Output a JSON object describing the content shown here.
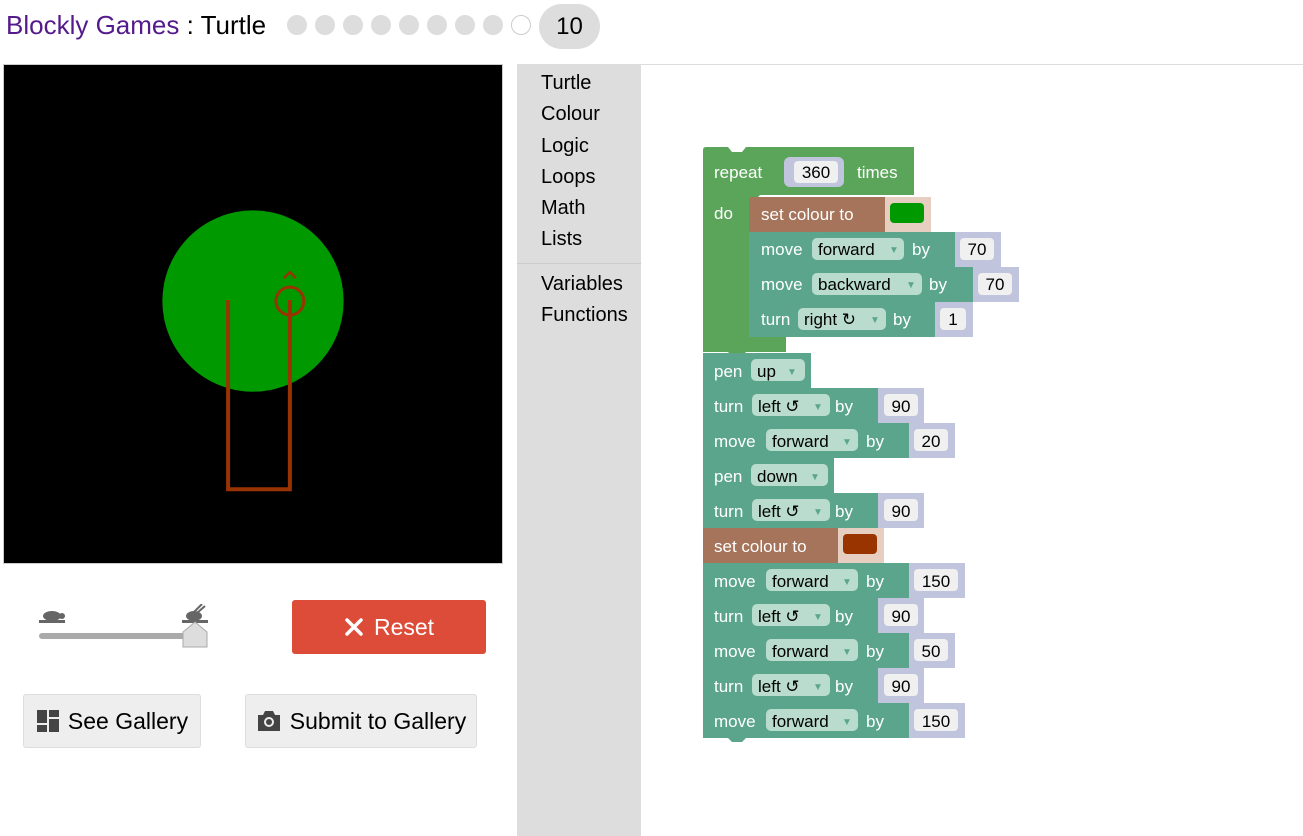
{
  "header": {
    "app_name": "Blockly Games",
    "separator": " : ",
    "level_name": "Turtle",
    "level_count": 10,
    "current_level": "10"
  },
  "controls": {
    "reset_label": "Reset",
    "see_gallery_label": "See Gallery",
    "submit_gallery_label": "Submit to Gallery",
    "speed_slow_icon": "turtle-icon",
    "speed_fast_icon": "rabbit-icon",
    "speed_value": 1.0
  },
  "toolbox": {
    "categories": [
      "Turtle",
      "Colour",
      "Logic",
      "Loops",
      "Math",
      "Lists",
      "Variables",
      "Functions"
    ]
  },
  "blocks": {
    "repeat": {
      "label": "repeat",
      "count": "360",
      "times": "times",
      "do": "do"
    },
    "by": "by",
    "set_colour": "set colour to",
    "move": "move",
    "turn": "turn",
    "pen": "pen",
    "inner": {
      "colour": "#009900",
      "move1_dir": "forward",
      "move1_val": "70",
      "move2_dir": "backward",
      "move2_val": "70",
      "turn_dir": "right ↻",
      "turn_val": "1"
    },
    "pen_up": "up",
    "turn1_dir": "left ↺",
    "turn1_val": "90",
    "move3_dir": "forward",
    "move3_val": "20",
    "pen_down": "down",
    "turn2_dir": "left ↺",
    "turn2_val": "90",
    "colour2": "#993300",
    "move4_dir": "forward",
    "move4_val": "150",
    "turn3_dir": "left ↺",
    "turn3_val": "90",
    "move5_dir": "forward",
    "move5_val": "50",
    "turn4_dir": "left ↺",
    "turn4_val": "90",
    "move6_dir": "forward",
    "move6_val": "150"
  },
  "colors": {
    "title_link": "#551a8b",
    "reset": "#dd4b39",
    "turtle_block": "#5ba58c",
    "loop_block": "#5ba55b",
    "colour_block": "#a5745b",
    "number_field": "#f0f0f0",
    "input_socket": "#c0c5dd"
  }
}
